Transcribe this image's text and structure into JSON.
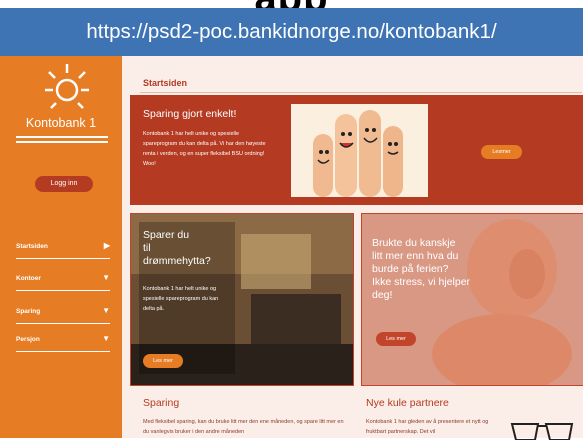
{
  "title_partial": "app",
  "url": "https://psd2-poc.bankidnorge.no/kontobank1/",
  "brand": {
    "name": "Kontobank 1"
  },
  "login_button": "Logg inn",
  "nav": [
    {
      "label": "Startsiden",
      "arrow": "▶"
    },
    {
      "label": "Kontoer",
      "arrow": "▼"
    },
    {
      "label": "Sparing",
      "arrow": "▼"
    },
    {
      "label": "Persjon",
      "arrow": "▼"
    }
  ],
  "page_title": "Startsiden",
  "hero": {
    "title": "Sparing gjort enkelt!",
    "text": "Kontobank 1 har helt unike og spesielle spareprogram du kan delta på. Vi har den høyeste renta i verden, og en super fleksibel BSU ordning! Woo!",
    "button": "Lesmer"
  },
  "card1": {
    "title_l1": "Sparer du",
    "title_l2": "til",
    "title_l3": "drømmehytta?",
    "text": "Kontobank 1 har helt unike og spesielle spareprogram du kan delta på.",
    "button": "Les mer"
  },
  "card2": {
    "title_l1": "Brukte du kanskje",
    "title_l2": "litt mer enn hva du",
    "title_l3": "burde på ferien?",
    "title_l4": "Ikke stress, vi hjelper",
    "title_l5": "deg!",
    "button": "Les mer"
  },
  "section1": {
    "title": "Sparing",
    "text": "Med fleksibel sparing, kan du bruke litt mer den ene måneden, og spare litt mer en du vanlegvis bruker i den andre måneden"
  },
  "section2": {
    "title": "Nye kule partnere",
    "text": "Kontobank 1 har gleden av å presentere et nytt og fruktbart partnerskap. Det vil"
  },
  "colors": {
    "orange": "#e67d24",
    "red": "#b43a22",
    "url_bar": "#3f74b4"
  },
  "icons": [
    "sun-logo-icon",
    "fingers-image",
    "cabin-image",
    "baby-image",
    "glasses-image"
  ]
}
